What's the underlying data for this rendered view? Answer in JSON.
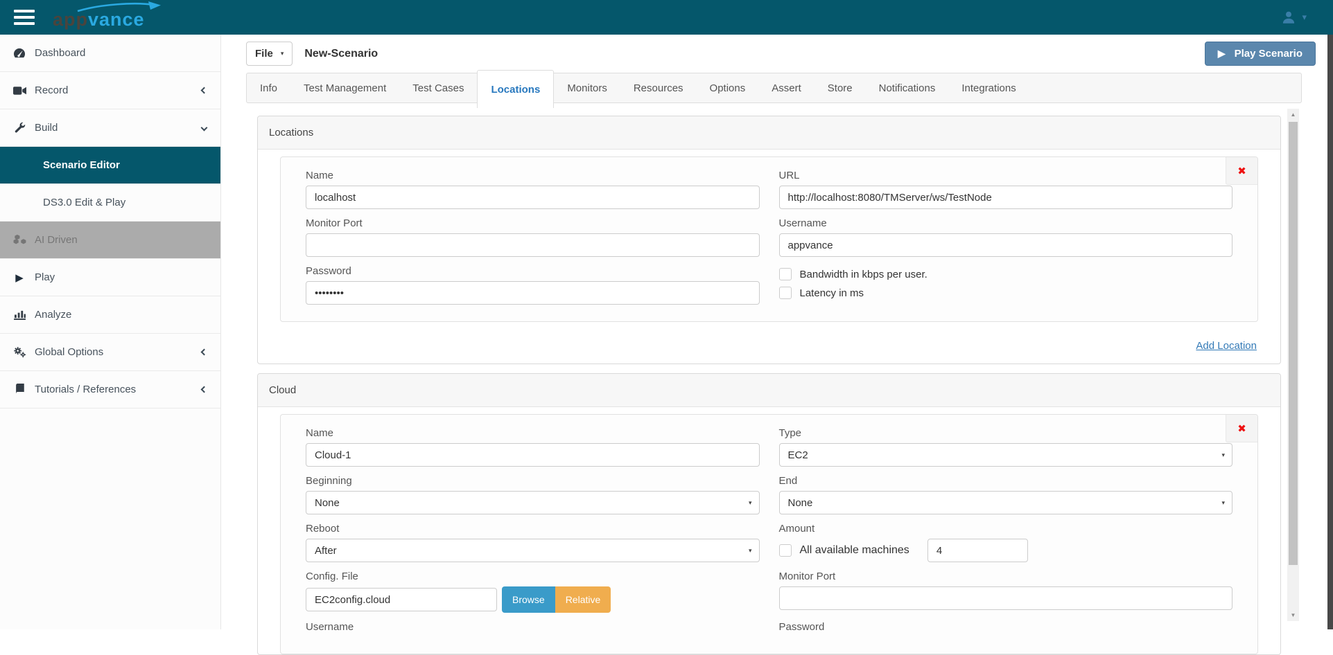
{
  "topbar": {
    "brand_part1": "app",
    "brand_part2": "vance",
    "colors": {
      "bar_bg": "#05576b",
      "brand_dark": "#4a443d",
      "brand_blue": "#2aa9e1",
      "user_icon_blue": "#3a7ea8"
    }
  },
  "sidebar": {
    "items": [
      {
        "label": "Dashboard",
        "icon": "dashboard-gauge-icon"
      },
      {
        "label": "Record",
        "icon": "video-camera-icon",
        "chevron": "left"
      },
      {
        "label": "Build",
        "icon": "wrench-icon",
        "chevron": "down"
      },
      {
        "label": "Scenario Editor",
        "active": true,
        "indent": true
      },
      {
        "label": "DS3.0 Edit & Play",
        "indent": true
      },
      {
        "label": "AI Driven",
        "icon": "cubes-icon",
        "disabled": true
      },
      {
        "label": "Play",
        "icon": "play-icon"
      },
      {
        "label": "Analyze",
        "icon": "bar-chart-icon"
      },
      {
        "label": "Global Options",
        "icon": "gears-icon",
        "chevron": "left"
      },
      {
        "label": "Tutorials / References",
        "icon": "book-icon",
        "chevron": "left"
      }
    ]
  },
  "toolbar": {
    "file_button": "File",
    "scenario_title": "New-Scenario",
    "play_button": "Play Scenario"
  },
  "tabs": [
    "Info",
    "Test Management",
    "Test Cases",
    "Locations",
    "Monitors",
    "Resources",
    "Options",
    "Assert",
    "Store",
    "Notifications",
    "Integrations"
  ],
  "active_tab": "Locations",
  "locations_panel": {
    "title": "Locations",
    "name_label": "Name",
    "name_value": "localhost",
    "url_label": "URL",
    "url_value": "http://localhost:8080/TMServer/ws/TestNode",
    "monitor_port_label": "Monitor Port",
    "monitor_port_value": "",
    "username_label": "Username",
    "username_value": "appvance",
    "password_label": "Password",
    "password_value": "••••••••",
    "bandwidth_checkbox_label": "Bandwidth in kbps per user.",
    "latency_checkbox_label": "Latency in ms",
    "delete_icon": "✖",
    "add_link": "Add Location"
  },
  "cloud_panel": {
    "title": "Cloud",
    "name_label": "Name",
    "name_value": "Cloud-1",
    "type_label": "Type",
    "type_value": "EC2",
    "beginning_label": "Beginning",
    "beginning_value": "None",
    "end_label": "End",
    "end_value": "None",
    "reboot_label": "Reboot",
    "reboot_value": "After",
    "amount_label": "Amount",
    "amount_checkbox_label": "All available machines",
    "amount_value": "4",
    "config_file_label": "Config. File",
    "config_file_value": "EC2config.cloud",
    "browse_button": "Browse",
    "relative_button": "Relative",
    "monitor_port_label": "Monitor Port",
    "monitor_port_value": "",
    "username_label": "Username",
    "password_label": "Password",
    "delete_icon": "✖"
  },
  "icons": {
    "play_glyph": "▶",
    "caret_down": "▾",
    "scroll_up": "▲",
    "scroll_down": "▼"
  },
  "colors": {
    "active_tab_blue": "#2878be",
    "play_button_blue": "#5b87ad",
    "browse_button_blue": "#3a9bc9",
    "relative_button_orange": "#f0ad4e",
    "delete_red": "#ee1111",
    "link_blue": "#337ab7",
    "disabled_item_gray": "#ababab",
    "active_item_teal": "#05576b"
  }
}
